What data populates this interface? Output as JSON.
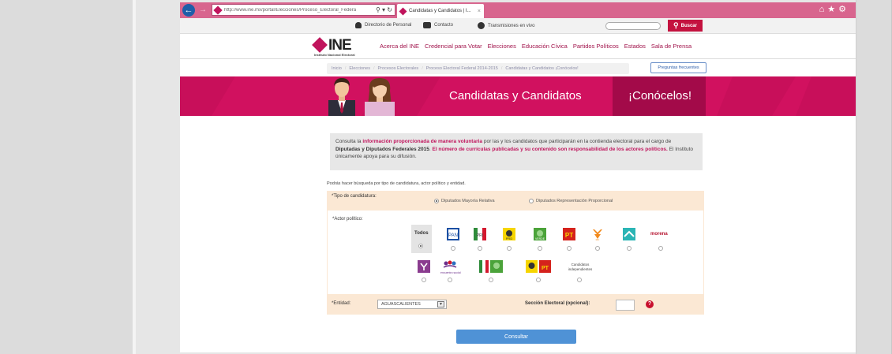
{
  "browser": {
    "url": "http://www.ine.mx/portal/Elecciones/Proceso_Electoral_Federa",
    "tab_title": "Candidatas y Candidatos | I...",
    "back_icon": "back-arrow-icon",
    "forward_icon": "forward-arrow-icon"
  },
  "utility": {
    "directorio": "Directorio de Personal",
    "contacto": "Contacto",
    "transmisiones": "Transmisiones en vivo",
    "buscar": "Buscar"
  },
  "header": {
    "logo_text": "INE",
    "logo_sub": "Instituto Nacional Electoral",
    "nav": [
      "Acerca del INE",
      "Credencial para Votar",
      "Elecciones",
      "Educación Cívica",
      "Partidos Políticos",
      "Estados",
      "Sala de Prensa"
    ]
  },
  "breadcrumb": {
    "items": [
      "Inicio",
      "Elecciones",
      "Procesos Electorales",
      "Proceso Electoral Federal 2014-2015",
      "Candidatas y Candidatos ¡Conócelos!"
    ],
    "faq": "Preguntas frecuentes"
  },
  "banner": {
    "title": "Candidatas y Candidatos",
    "subtitle": "¡Conócelos!",
    "color": "#d1115f"
  },
  "info": {
    "p1": "Consulta la ",
    "p1_em": "información proporcionada de manera voluntaria",
    "p2": " por las y los candidatos que participarán en la contienda electoral para el cargo de ",
    "p2_b": "Diputadas y Diputados Federales 2015",
    "p3": ". ",
    "p3_em": "El número de currículas publicadas y su contenido son responsabilidad de los actores políticos.",
    "p4": " El Instituto únicamente apoya para su difusión."
  },
  "form": {
    "help": "Podrás hacer búsqueda por tipo de candidatura, actor político y entidad.",
    "tipo_label": "*Tipo de candidatura:",
    "tipo_opt1": "Diputados Mayoría Relativa",
    "tipo_opt2": "Diputados Representación Proporcional",
    "actor_label": "*Actor político:",
    "todos": "Todos",
    "candidatos_ind": "Candidatos independientes",
    "encuentro": "encuentro social",
    "morena": "morena",
    "entidad_label": "*Entidad:",
    "entidad_value": "AGUASCALIENTES",
    "seccion_label": "Sección Electoral (opcional):",
    "consultar": "Consultar"
  }
}
